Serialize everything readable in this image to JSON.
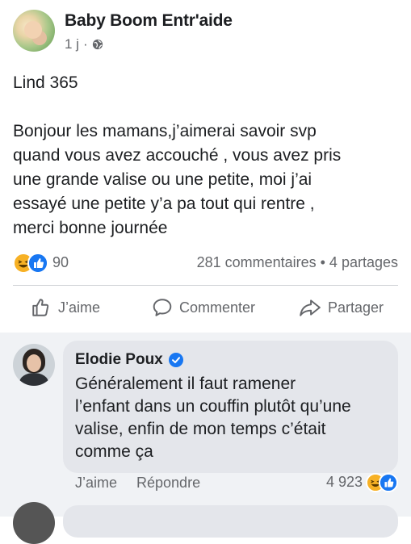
{
  "post": {
    "group_name": "Baby Boom Entr'aide",
    "time": "1 j",
    "separator": "·",
    "title_line": "Lind 365",
    "body_lines": [
      "Bonjour les mamans,j’aimerai savoir svp",
      "quand vous avez accouché , vous avez pris",
      "une grande valise ou une petite, moi j’ai",
      "essayé une petite y’a pa tout qui rentre ,",
      "merci bonne journée"
    ],
    "reaction_count": "90",
    "comment_stats": "281 commentaires • 4 partages",
    "reaction_icons": [
      "haha-emoji-icon",
      "like-thumb-icon"
    ]
  },
  "actions": {
    "like_label": "J’aime",
    "comment_label": "Commenter",
    "share_label": "Partager"
  },
  "comment": {
    "author": "Elodie Poux",
    "verified": true,
    "text_lines": [
      "Généralement il faut ramener",
      "l’enfant dans un couffin plutôt qu’une",
      "valise, enfin de mon temps c’était",
      "comme ça"
    ],
    "like_label": "J’aime",
    "reply_label": "Répondre",
    "reaction_count": "4 923"
  },
  "colors": {
    "facebook_blue": "#1877f2",
    "haha_yellow": "#f7b125",
    "muted_text": "#65676b",
    "comment_bg": "#f0f2f5",
    "bubble_bg": "#e4e6eb"
  }
}
